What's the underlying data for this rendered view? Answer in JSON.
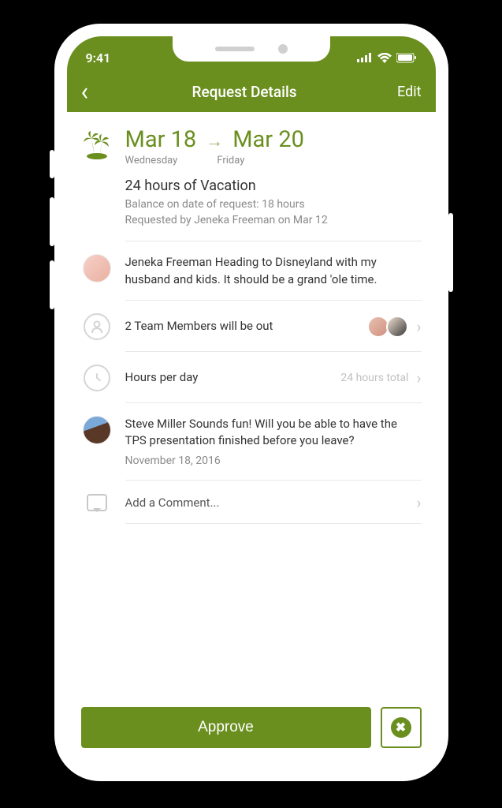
{
  "status": {
    "time": "9:41"
  },
  "nav": {
    "title": "Request Details",
    "edit": "Edit"
  },
  "dates": {
    "start": "Mar 18",
    "end": "Mar 20",
    "start_day": "Wednesday",
    "end_day": "Friday"
  },
  "summary": {
    "title": "24 hours of Vacation",
    "balance": "Balance on date of request: 18 hours",
    "requested_by": "Requested by Jeneka Freeman on Mar 12"
  },
  "note": {
    "text": "Jeneka Freeman Heading to Disneyland with my husband and kids. It should be a grand 'ole time."
  },
  "team_out": {
    "label": "2 Team Members will be out"
  },
  "hours": {
    "label": "Hours per day",
    "value": "24 hours total"
  },
  "comment1": {
    "text": "Steve Miller Sounds fun! Will you be able to have the TPS presentation finished before you leave?",
    "date": "November 18, 2016"
  },
  "add_comment": {
    "placeholder": "Add a Comment..."
  },
  "footer": {
    "approve": "Approve"
  }
}
